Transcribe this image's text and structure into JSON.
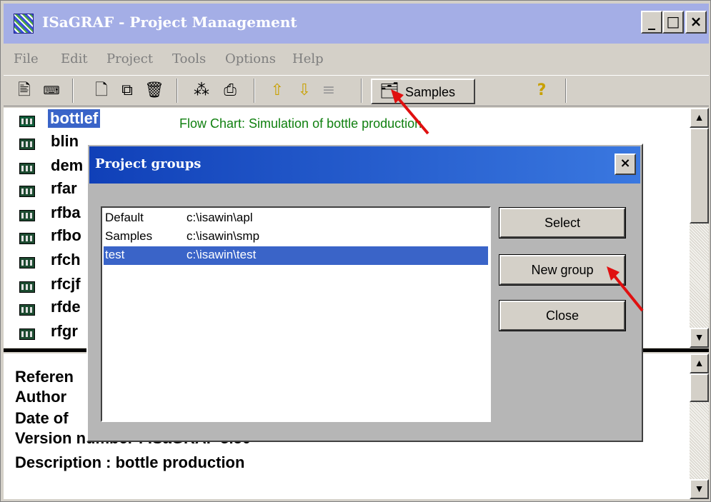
{
  "window": {
    "title": "ISaGRAF - Project Management",
    "controls": [
      "_",
      "□",
      "×"
    ]
  },
  "menu": [
    {
      "label": "File"
    },
    {
      "label": "Edit"
    },
    {
      "label": "Project"
    },
    {
      "label": "Tools"
    },
    {
      "label": "Options"
    },
    {
      "label": "Help"
    }
  ],
  "toolbar": {
    "samples_label": "Samples",
    "help_icon": "?"
  },
  "projects": [
    {
      "name": "bottlef",
      "description": "Flow Chart: Simulation of bottle production",
      "selected": true
    },
    {
      "name": "blin"
    },
    {
      "name": "dem"
    },
    {
      "name": "rfar"
    },
    {
      "name": "rfba"
    },
    {
      "name": "rfbo"
    },
    {
      "name": "rfch"
    },
    {
      "name": "rfcjf"
    },
    {
      "name": "rfde"
    },
    {
      "name": "rfgr"
    }
  ],
  "info": {
    "reference": "Referen",
    "author": "Author",
    "date": "Date of",
    "version": "Version number   : ISaGRAF 3.50",
    "description": "Description     : bottle production"
  },
  "dialog": {
    "title": "Project groups",
    "close": "×",
    "groups": [
      {
        "name": "Default",
        "path": "c:\\isawin\\apl"
      },
      {
        "name": "Samples",
        "path": "c:\\isawin\\smp"
      },
      {
        "name": "test",
        "path": "c:\\isawin\\test",
        "selected": true
      }
    ],
    "buttons": {
      "select": "Select",
      "new_group": "New group",
      "close": "Close"
    }
  },
  "colors": {
    "title_bar": "#a4aee6",
    "selection": "#3a64c8",
    "description_text": "#108010",
    "annotation_arrow": "#e01010"
  }
}
